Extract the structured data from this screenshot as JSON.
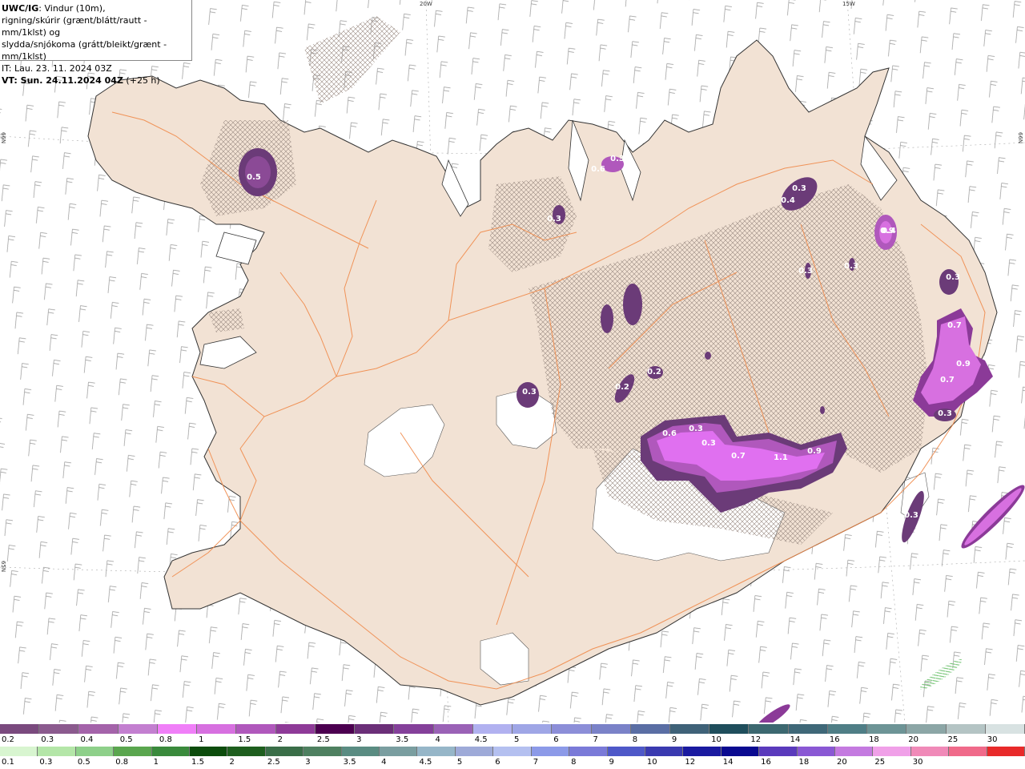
{
  "title": {
    "model": "UWC/IG",
    "line1": ": Vindur (10m),",
    "line2": "rigning/skúrir (grænt/blátt/rautt - mm/1klst) og",
    "line3": "slydda/snjókoma (grátt/bleikt/grænt - mm/1klst)",
    "it": "IT: Lau. 23. 11. 2024 03Z",
    "vt_bold": "VT: Sun. 24.11.2024 04Z",
    "vt_rest": " (+25 h)"
  },
  "coords": {
    "lon20": "20W",
    "lon15": "15W",
    "lat66_left": "66N",
    "lat66_right": "66N",
    "lat65_left": "65N"
  },
  "precip_labels": [
    "0.5",
    "0.6",
    "0.3",
    "0.3",
    "0.4",
    "0.9",
    "0.3",
    "0.3",
    "0.3",
    "0.3",
    "0.4",
    "0.7",
    "0.9",
    "0.7",
    "0.3",
    "0.2",
    "0.2",
    "0.3",
    "0.6",
    "0.3",
    "0.7",
    "1.1",
    "0.9",
    "0.3",
    "0.3"
  ],
  "colors": {
    "land": "#f2e2d4",
    "sea": "#ffffff",
    "roads": "#f08a4a",
    "glacier": "#ffffff",
    "precip_light": "#d46ad8",
    "precip_mid": "#a050a8",
    "precip_dark": "#6b3b78",
    "precip_bright": "#e070f0"
  },
  "snow_scale": {
    "colors": [
      "#7a4a7e",
      "#8b5a8e",
      "#a463aa",
      "#c37fd0",
      "#f07ff8",
      "#d770e0",
      "#b058bc",
      "#8e3a98",
      "#4c0050",
      "#6b2f78",
      "#84409a",
      "#9a62b6",
      "#b1b1f0",
      "#9fa6e6",
      "#8c8ed8",
      "#7a82c8",
      "#5a6ea4",
      "#3f6278",
      "#1f4e5c",
      "#3c6870",
      "#3f6878",
      "#4f7e86",
      "#6d9496",
      "#8ca6a6",
      "#b4c4c4",
      "#d8e2e2"
    ],
    "ticks": [
      "0.2",
      "0.3",
      "0.4",
      "0.5",
      "0.8",
      "1",
      "1.5",
      "2",
      "2.5",
      "3",
      "3.5",
      "4",
      "4.5",
      "5",
      "6",
      "7",
      "8",
      "9",
      "10",
      "12",
      "14",
      "16",
      "18",
      "20",
      "25",
      "30"
    ]
  },
  "rain_scale": {
    "colors": [
      "#d8f5d0",
      "#b4e6a8",
      "#8ed08a",
      "#5aa64e",
      "#3a8a3c",
      "#0c4c0c",
      "#1e5e1e",
      "#3a6e48",
      "#4e8060",
      "#5a8c82",
      "#7a9ea0",
      "#96b6c8",
      "#9eaad8",
      "#b4c0f0",
      "#8c9ae8",
      "#7a7ad8",
      "#4e58c8",
      "#3a3ab0",
      "#1a1aa0",
      "#0a0a90",
      "#5a3abc",
      "#8a58d4",
      "#c47ae0",
      "#f0a0e8",
      "#f08ab8",
      "#f06a8a",
      "#e82a2a"
    ],
    "ticks": [
      "0.1",
      "0.3",
      "0.5",
      "0.8",
      "1",
      "1.5",
      "2",
      "2.5",
      "3",
      "3.5",
      "4",
      "4.5",
      "5",
      "6",
      "7",
      "8",
      "9",
      "10",
      "12",
      "14",
      "16",
      "18",
      "20",
      "25",
      "30"
    ]
  }
}
